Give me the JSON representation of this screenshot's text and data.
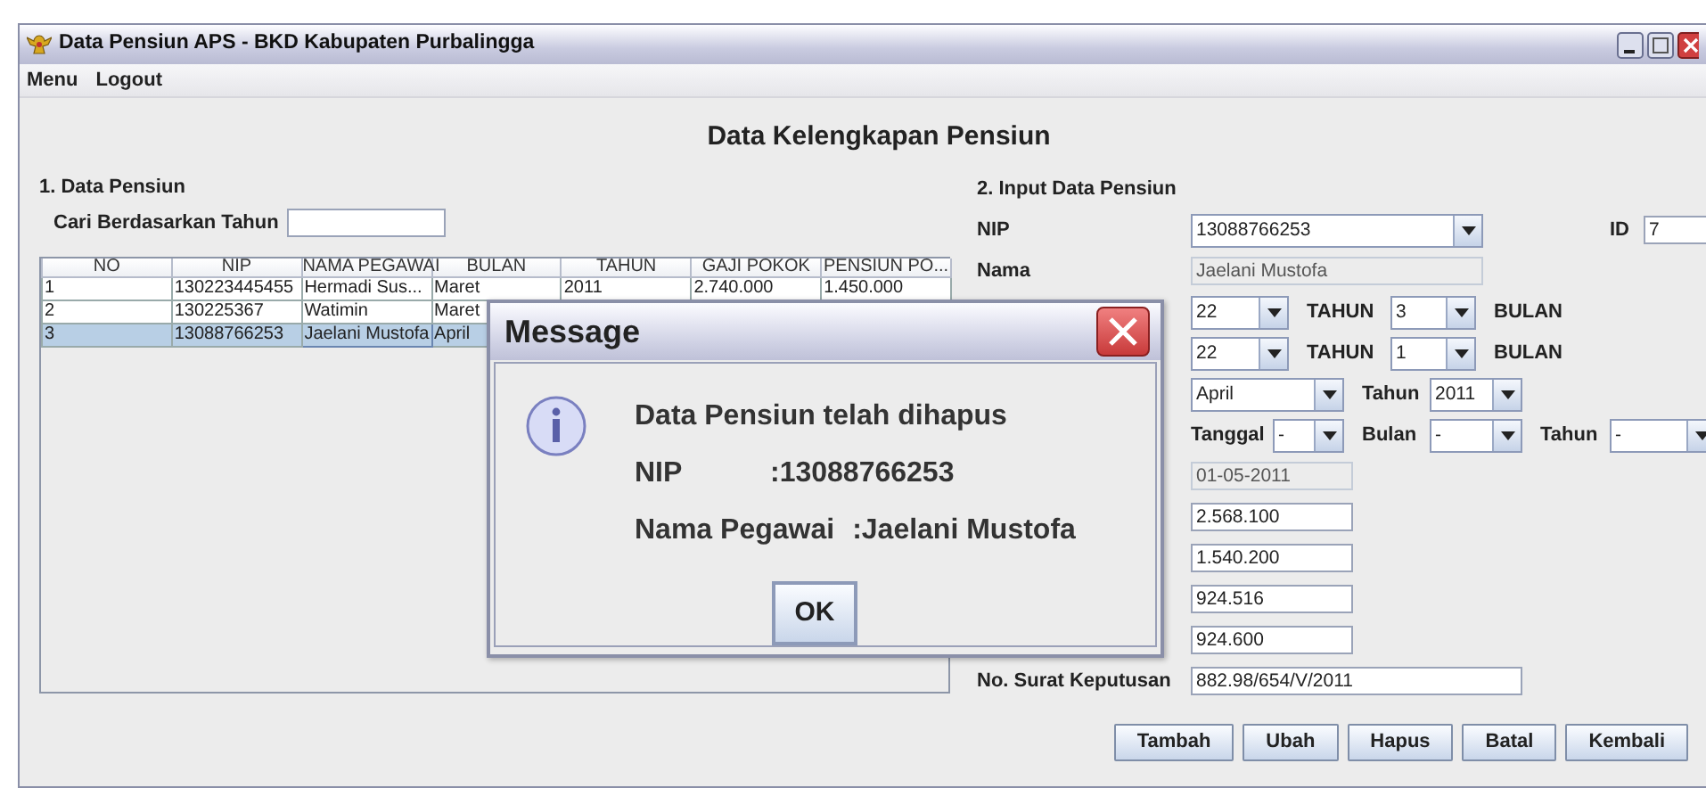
{
  "window": {
    "title": "Data Pensiun APS - BKD Kabupaten Purbalingga"
  },
  "menu_bar": [
    "Menu",
    "Logout"
  ],
  "heading": "Data Kelengkapan Pensiun",
  "data_pensiun": {
    "title": "1. Data Pensiun",
    "search_label": "Cari Berdasarkan Tahun",
    "table": {
      "columns": [
        "NO",
        "NIP",
        "NAMA PEGAWAI",
        "BULAN",
        "TAHUN",
        "GAJI POKOK",
        "PENSIUN PO..."
      ],
      "rows": [
        {
          "cells": [
            "1",
            "130223445455",
            "Hermadi Sus...",
            "Maret",
            "2011",
            "2.740.000",
            "1.450.000"
          ],
          "selected": false
        },
        {
          "cells": [
            "2",
            "130225367",
            "Watimin",
            "Maret"
          ],
          "selected": false
        },
        {
          "cells": [
            "3",
            "13088766253",
            "Jaelani Mustofa",
            "April"
          ],
          "selected": true
        }
      ]
    }
  },
  "input_data": {
    "title": "2. Input Data Pensiun",
    "nip": {
      "label": "NIP",
      "value": "13088766253"
    },
    "id": {
      "label": "ID",
      "value": "7"
    },
    "nama": {
      "label": "Nama",
      "value": "Jaelani Mustofa",
      "disabled": true
    },
    "masa_kerja": [
      {
        "years": "22",
        "years_unit": "TAHUN",
        "months": "3",
        "months_unit": "BULAN"
      },
      {
        "years": "22",
        "years_unit": "TAHUN",
        "months": "1",
        "months_unit": "BULAN"
      }
    ],
    "periode": {
      "month": "April",
      "year_label": "Tahun",
      "year": "2011"
    },
    "tanggal": [
      {
        "label": "Tanggal",
        "value": "-"
      },
      {
        "label": "Bulan",
        "value": "-"
      },
      {
        "label": "Tahun",
        "value": "-"
      }
    ],
    "fields": [
      {
        "value": "01-05-2011",
        "disabled": true
      },
      {
        "value": "2.568.100",
        "disabled": false
      },
      {
        "value": "1.540.200",
        "disabled": false
      },
      {
        "value": "924.516",
        "disabled": false
      },
      {
        "value": "924.600",
        "disabled": false
      }
    ],
    "surat": {
      "label": "No. Surat Keputusan",
      "value": "882.98/654/V/2011"
    }
  },
  "buttons": [
    "Tambah",
    "Ubah",
    "Hapus",
    "Batal",
    "Kembali"
  ],
  "dialog": {
    "title": "Message",
    "message": "Data Pensiun telah dihapus",
    "details": [
      {
        "label": "NIP",
        "value": ":13088766253"
      },
      {
        "label": "Nama Pegawai",
        "value": ":Jaelani Mustofa"
      }
    ],
    "button": "OK"
  }
}
